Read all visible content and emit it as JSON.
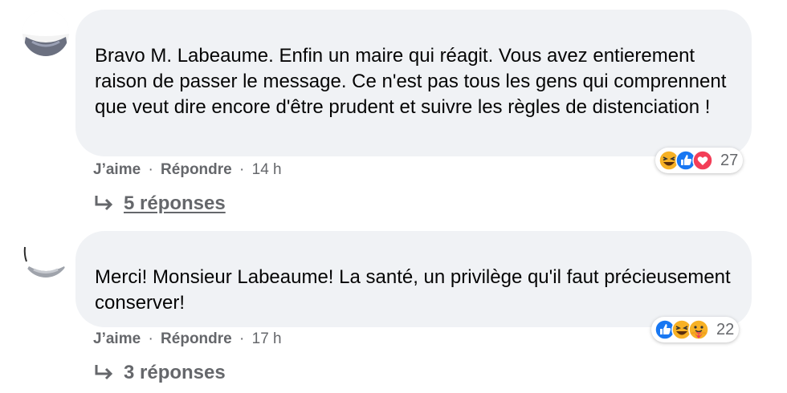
{
  "comments": [
    {
      "text": "Bravo M. Labeaume. Enfin un maire qui réagit. Vous avez entierement raison de passer le message. Ce n'est pas tous les gens qui comprennent que veut dire encore d'être prudent et suivre les règles de distenciation !",
      "like_label": "J’aime",
      "reply_label": "Répondre",
      "time": "14 h",
      "separator": "·",
      "reactions": [
        "haha-icon",
        "like-icon",
        "love-icon"
      ],
      "reaction_count": "27",
      "replies_label": "5 réponses"
    },
    {
      "text": "Merci! Monsieur Labeaume! La santé, un privilège qu'il faut précieusement conserver!",
      "like_label": "J’aime",
      "reply_label": "Répondre",
      "time": "17 h",
      "separator": "·",
      "reactions": [
        "like-icon",
        "haha-icon",
        "care-icon"
      ],
      "reaction_count": "22",
      "replies_label": "3 réponses"
    }
  ],
  "colors": {
    "bubble": "#f0f2f5",
    "secondary_text": "#65676b",
    "like_blue": "#1877f2",
    "love_red": "#f33e58",
    "haha_yellow": "#f7b125"
  }
}
